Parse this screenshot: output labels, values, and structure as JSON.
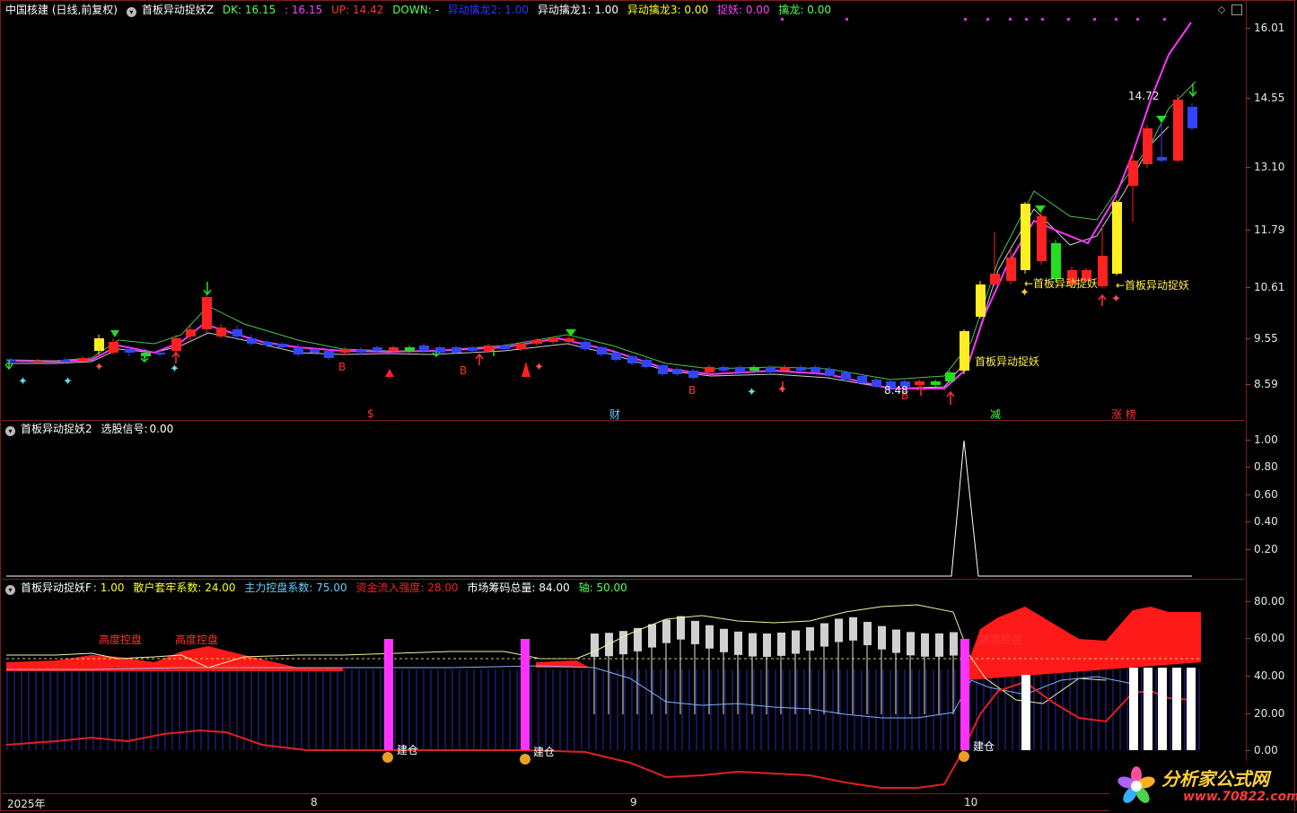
{
  "header": {
    "stock": "中国核建 (日线,前复权)",
    "indicator": "首板异动捉妖Z",
    "dk_label": "DK:",
    "dk_value": "16.15",
    "dk2_value": ": 16.15",
    "up_label": "UP:",
    "up_value": "14.42",
    "down_label": "DOWN:",
    "down_value": "-",
    "q2_label": "异动擒龙2:",
    "q2_value": "1.00",
    "q1_label": "异动擒龙1:",
    "q1_value": "1.00",
    "q3_label": "异动擒龙3:",
    "q3_value": "0.00",
    "zy_label": "捉妖:",
    "zy_value": "0.00",
    "ql_label": "擒龙:",
    "ql_value": "0.00"
  },
  "main_pane": {
    "price_ticks": [
      "16.01",
      "14.55",
      "13.10",
      "11.79",
      "10.61",
      "9.55",
      "8.59"
    ],
    "annotations": {
      "high_label": "14.72",
      "low_label": "8.48",
      "tag1": "首板异动捉妖",
      "tag2": "←首板异动捉妖",
      "tag3": "←首板异动捉妖",
      "marker_s": "$",
      "marker_cai": "财",
      "marker_jian": "减",
      "marker_zhang": "涨",
      "marker_bang": "榜",
      "b_label": "B"
    }
  },
  "pane2": {
    "title": "首板异动捉妖2",
    "signal_label": "选股信号:",
    "signal_value": "0.00",
    "ticks": [
      "1.00",
      "0.80",
      "0.60",
      "0.40",
      "0.20"
    ]
  },
  "pane3": {
    "title": "首板异动捉妖F",
    "f_value": ": 1.00",
    "s1_label": "散户套牢系数:",
    "s1_value": "24.00",
    "s2_label": "主力控盘系数:",
    "s2_value": "75.00",
    "s3_label": "资金流入强度:",
    "s3_value": "28.00",
    "s4_label": "市场筹码总量:",
    "s4_value": "84.00",
    "s5_label": "轴:",
    "s5_value": "50.00",
    "ticks": [
      "80.00",
      "60.00",
      "40.00",
      "20.00",
      "0.00"
    ],
    "label_gaodu": "高度控盘",
    "label_jiancang": "建仓"
  },
  "xaxis": {
    "labels": [
      "2025年",
      "8",
      "9",
      "10"
    ]
  },
  "logo": {
    "text": "分析家公式网",
    "url": "www.70822.com"
  },
  "colors": {
    "up": "#ff2a2a",
    "down": "#3344ff",
    "ma": "#ff44ff",
    "accent_yellow": "#ffff22",
    "magenta": "#ff33ff"
  }
}
